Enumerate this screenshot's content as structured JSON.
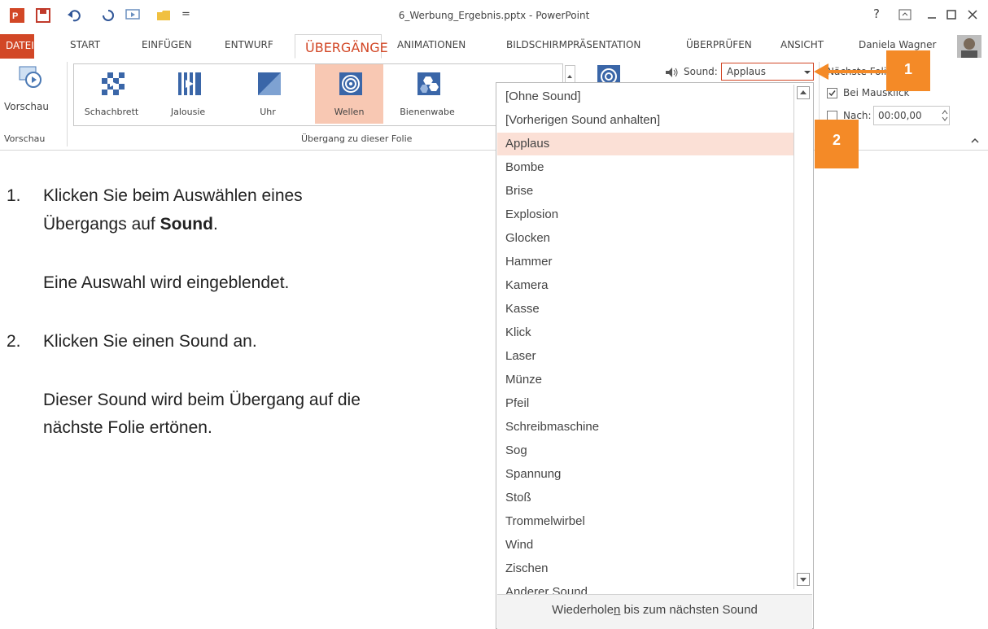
{
  "title_bar": {
    "title": "6_Werbung_Ergebnis.pptx - PowerPoint",
    "help": "?",
    "qat_more": "="
  },
  "tabs": [
    "DATEI",
    "START",
    "EINFÜGEN",
    "ENTWURF",
    "ÜBERGÄNGE",
    "ANIMATIONEN",
    "BILDSCHIRMPRÄSENTATION",
    "ÜBERPRÜFEN",
    "ANSICHT"
  ],
  "user": {
    "name": "Daniela Wagner"
  },
  "ribbon": {
    "preview_button": "Vorschau",
    "preview_group": "Vorschau",
    "transition_group": "Übergang zu dieser Folie",
    "gallery": [
      {
        "label": "Schachbrett"
      },
      {
        "label": "Jalousie"
      },
      {
        "label": "Uhr"
      },
      {
        "label": "Wellen",
        "selected": true
      },
      {
        "label": "Bienenwabe"
      }
    ],
    "sound_label": "Sound:",
    "sound_value": "Applaus",
    "next_slide_label": "Nächste Folie",
    "on_click_label": "Bei Mausklick",
    "after_label": "Nach:",
    "after_value": "00:00,00"
  },
  "sound_list": {
    "items": [
      "[Ohne Sound]",
      "[Vorherigen Sound anhalten]",
      "Applaus",
      "Bombe",
      "Brise",
      "Explosion",
      "Glocken",
      "Hammer",
      "Kamera",
      "Kasse",
      "Klick",
      "Laser",
      "Münze",
      "Pfeil",
      "Schreibmaschine",
      "Sog",
      "Spannung",
      "Stoß",
      "Trommelwirbel",
      "Wind",
      "Zischen",
      "Anderer Sound..."
    ],
    "selected": "Applaus",
    "footer_pre": "Wiederhole",
    "footer_u": "n",
    "footer_post": " bis zum nächsten Sound"
  },
  "callouts": [
    "1",
    "2"
  ],
  "instructions": {
    "step1_num": "1.",
    "step1_line1": "Klicken Sie beim Auswählen eines",
    "step1_line2_pre": "Übergangs auf ",
    "step1_line2_bold": "Sound",
    "step1_line2_post": ".",
    "step1_note": "Eine Auswahl wird eingeblendet.",
    "step2_num": "2.",
    "step2_line1": "Klicken Sie einen Sound an.",
    "step2_note_line1": "Dieser Sound wird beim Übergang auf die",
    "step2_note_line2": "nächste Folie ertönen."
  },
  "colors": {
    "accent": "#d24726",
    "callout": "#f48a27",
    "selected": "#fbe0d6"
  }
}
